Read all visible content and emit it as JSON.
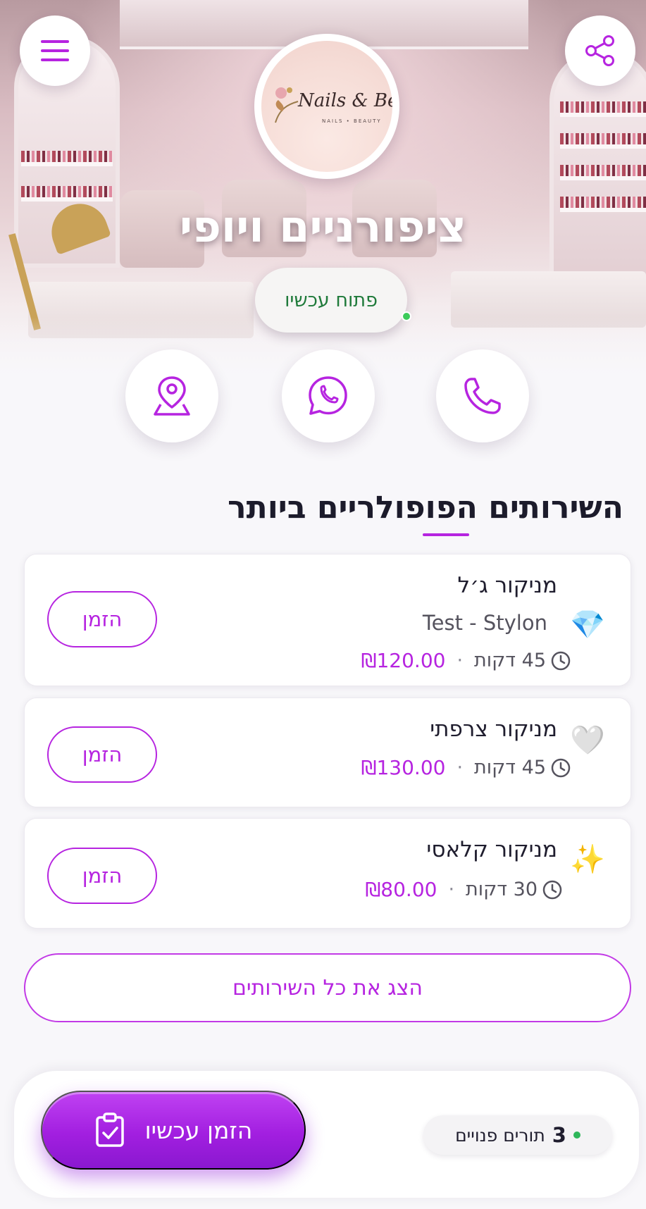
{
  "business": {
    "name": "ציפורניים ויופי",
    "logo_text": "Nails & Beauty",
    "logo_subtext": "NAILS • BEAUTY",
    "status": "פתוח עכשיו"
  },
  "header": {
    "menu_icon": "hamburger-menu-icon",
    "share_icon": "share-icon"
  },
  "actions": {
    "location_icon": "map-pin-icon",
    "whatsapp_icon": "whatsapp-icon",
    "phone_icon": "phone-icon"
  },
  "popular": {
    "title": "השירותים הפופולריים ביותר",
    "services": [
      {
        "name": "מניקור ג׳ל",
        "subtitle": "Test - Stylon",
        "emoji": "💎",
        "duration": "45 דקות",
        "price": "₪120.00",
        "book_label": "הזמן"
      },
      {
        "name": "מניקור צרפתי",
        "emoji": "🤍",
        "duration": "45 דקות",
        "price": "₪130.00",
        "book_label": "הזמן"
      },
      {
        "name": "מניקור קלאסי",
        "emoji": "✨",
        "duration": "30 דקות",
        "price": "₪80.00",
        "book_label": "הזמן"
      }
    ],
    "show_all_label": "הצג את כל השירותים"
  },
  "bottom_bar": {
    "book_now_label": "הזמן עכשיו",
    "slots_count": "3",
    "slots_label": "תורים פנויים"
  },
  "colors": {
    "accent": "#b624e0",
    "status_green": "#1f7a3a"
  }
}
